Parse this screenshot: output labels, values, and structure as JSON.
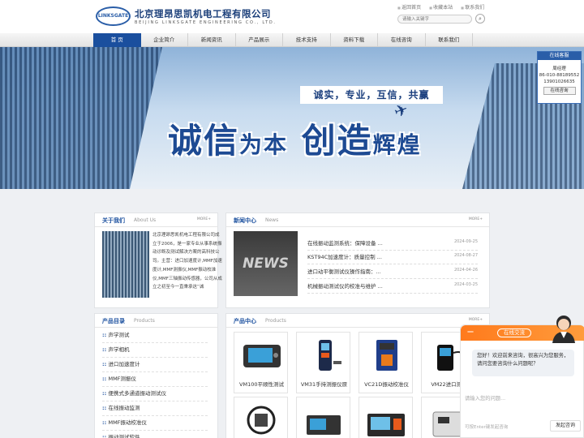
{
  "header": {
    "logo_text": "LINKSGATE",
    "company_cn": "北京理昂思凯机电工程有限公司",
    "company_en": "BEIJING LINKSGATE ENGINEERING CO., LTD.",
    "top_links": [
      "返回首页",
      "收藏本站",
      "联系我们"
    ],
    "search_placeholder": "请输入关键字",
    "search_button_icon": "search-icon"
  },
  "nav": {
    "items": [
      "首 页",
      "企业简介",
      "新闻资讯",
      "产品展示",
      "技术支持",
      "资料下载",
      "在线咨询",
      "联系我们"
    ],
    "active_index": 0
  },
  "banner": {
    "slogan_small": "诚实，专业，互信，共赢",
    "slogan_big_1": "诚信",
    "slogan_big_2": "为本",
    "slogan_big_3": "创造",
    "slogan_big_4": "辉煌",
    "icon": "airplane-icon"
  },
  "float_contact": {
    "title": "在线客服",
    "name": "周经理",
    "phone1": "86-010-88189552",
    "phone2": "13901026635",
    "button": "在线咨询"
  },
  "about": {
    "title_cn": "关于我们",
    "title_en": "About Us",
    "more": "MORE+",
    "text": "北京理昂思凯机电工程有限公司成立于2006，是一家专业从事系统振动诊断及测试解决方案的高科技公司。主营：进口加速度计,MMF加速度计,MMF测振仪,MMF振动校准仪,MMF三轴振动传感器，公司从成立之初至今一直秉承这“诚"
  },
  "news": {
    "title_cn": "新闻中心",
    "title_en": "News",
    "more": "MORE+",
    "image_text": "NEWS",
    "items": [
      {
        "title": "在线振动监测系统：保障设备 ...",
        "date": "2024-09-25"
      },
      {
        "title": "KST94C加速度计：质量控制 ...",
        "date": "2024-08-27"
      },
      {
        "title": "进口动平衡测试仪操作指南：...",
        "date": "2024-04-26"
      },
      {
        "title": "机械振动测试仪的校准与维护 ...",
        "date": "2024-03-25"
      }
    ]
  },
  "product_catalog": {
    "title_cn": "产品目录",
    "title_en": "Products",
    "items": [
      "声学测试",
      "声学相机",
      "进口加速度计",
      "MMF测振仪",
      "便携式多通道振动测试仪",
      "在线振动监测",
      "MMF振动校准仪",
      "振动测试软件"
    ]
  },
  "product_center": {
    "title_cn": "产品中心",
    "title_en": "Products",
    "more": "MORE+",
    "items": [
      "VM100平顺性测试",
      "VM31手持测振仪原",
      "VC21D振动校准仪",
      "VM22进口测振"
    ]
  },
  "chat": {
    "title": "在线交流",
    "minimize": "—",
    "greeting": "您好！欢迎前来咨询，很高兴为您服务，请问您要咨询什么问题呢？",
    "input_placeholder": "请输入您的问题...",
    "hint": "可按Enter键发起咨询",
    "send_button": "发起咨询"
  },
  "colors": {
    "primary": "#1a4f9e",
    "accent_orange": "#ff8a2a",
    "background": "#eef0f3"
  }
}
